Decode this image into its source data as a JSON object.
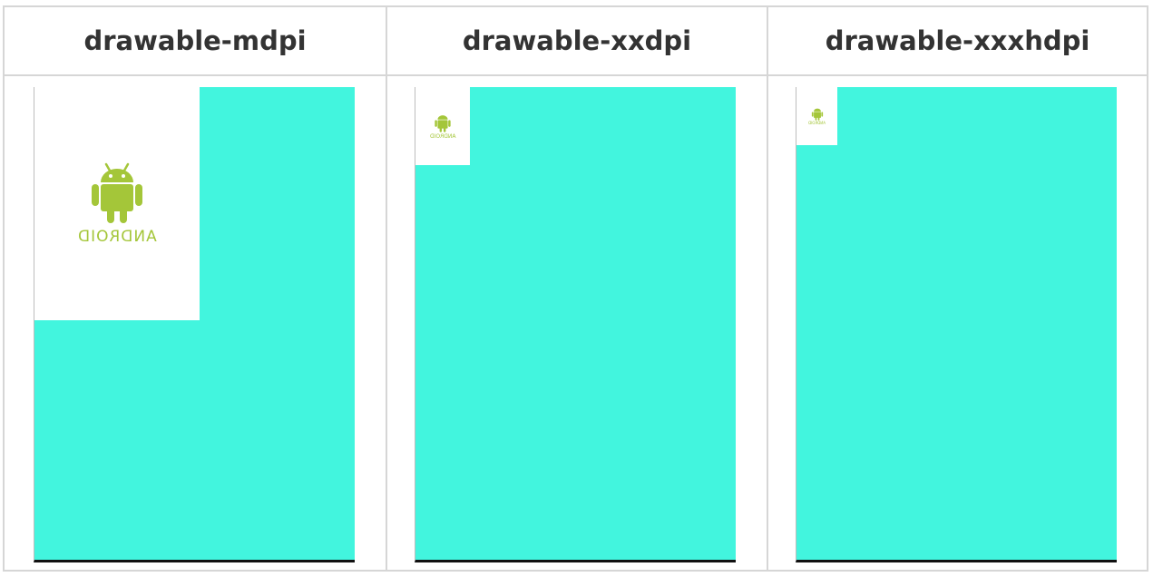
{
  "columns": [
    {
      "header": "drawable-mdpi",
      "wordmark": "ANDROID"
    },
    {
      "header": "drawable-xxdpi",
      "wordmark": "ANDROID"
    },
    {
      "header": "drawable-xxxhdpi",
      "wordmark": "ANDROID"
    }
  ],
  "colors": {
    "screen_background": "#42f5de",
    "android_green": "#a4c639",
    "tile_background": "#ffffff"
  },
  "icons": [
    "android-logo-icon"
  ]
}
